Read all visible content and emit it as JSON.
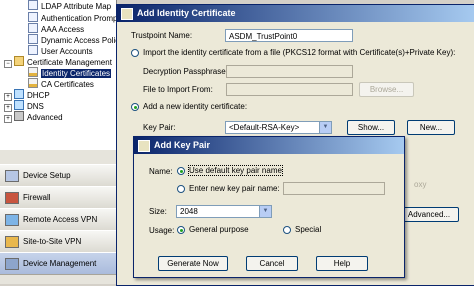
{
  "tree": {
    "items": [
      {
        "label": "LDAP Attribute Map",
        "icon": "page-icon"
      },
      {
        "label": "Authentication Promp",
        "icon": "page-icon"
      },
      {
        "label": "AAA Access",
        "icon": "page-icon"
      },
      {
        "label": "Dynamic Access Polici",
        "icon": "page-icon"
      },
      {
        "label": "User Accounts",
        "icon": "page-icon"
      },
      {
        "label": "Certificate Management",
        "icon": "folder-icon"
      },
      {
        "label": "Identity Certificates",
        "icon": "certificate-icon"
      },
      {
        "label": "CA Certificates",
        "icon": "certificate-icon"
      },
      {
        "label": "DHCP",
        "icon": "network-icon"
      },
      {
        "label": "DNS",
        "icon": "network-icon"
      },
      {
        "label": "Advanced",
        "icon": "advanced-icon"
      }
    ]
  },
  "nav": {
    "device_setup": "Device Setup",
    "firewall": "Firewall",
    "remote_access_vpn": "Remote Access VPN",
    "site_to_site_vpn": "Site-to-Site VPN",
    "device_management": "Device Management"
  },
  "identity_dialog": {
    "title": "Add Identity Certificate",
    "trustpoint_label": "Trustpoint Name:",
    "trustpoint_value": "ASDM_TrustPoint0",
    "import_option": "Import the identity certificate from a file (PKCS12 format with Certificate(s)+Private Key):",
    "passphrase_label": "Decryption Passphrase:",
    "file_label": "File to Import From:",
    "browse_button": "Browse...",
    "add_new_option": "Add a new identity certificate:",
    "key_pair_label": "Key Pair:",
    "key_pair_value": "<Default-RSA-Key>",
    "show_button": "Show...",
    "new_button": "New...",
    "partial_text": "oxy",
    "advanced_button": "Advanced..."
  },
  "keypair_dialog": {
    "title": "Add Key Pair",
    "name_label": "Name:",
    "default_option": "Use default key pair name",
    "new_name_option": "Enter new key pair name:",
    "size_label": "Size:",
    "size_value": "2048",
    "usage_label": "Usage:",
    "general_option": "General purpose",
    "special_option": "Special",
    "generate_button": "Generate Now",
    "cancel_button": "Cancel",
    "help_button": "Help"
  }
}
